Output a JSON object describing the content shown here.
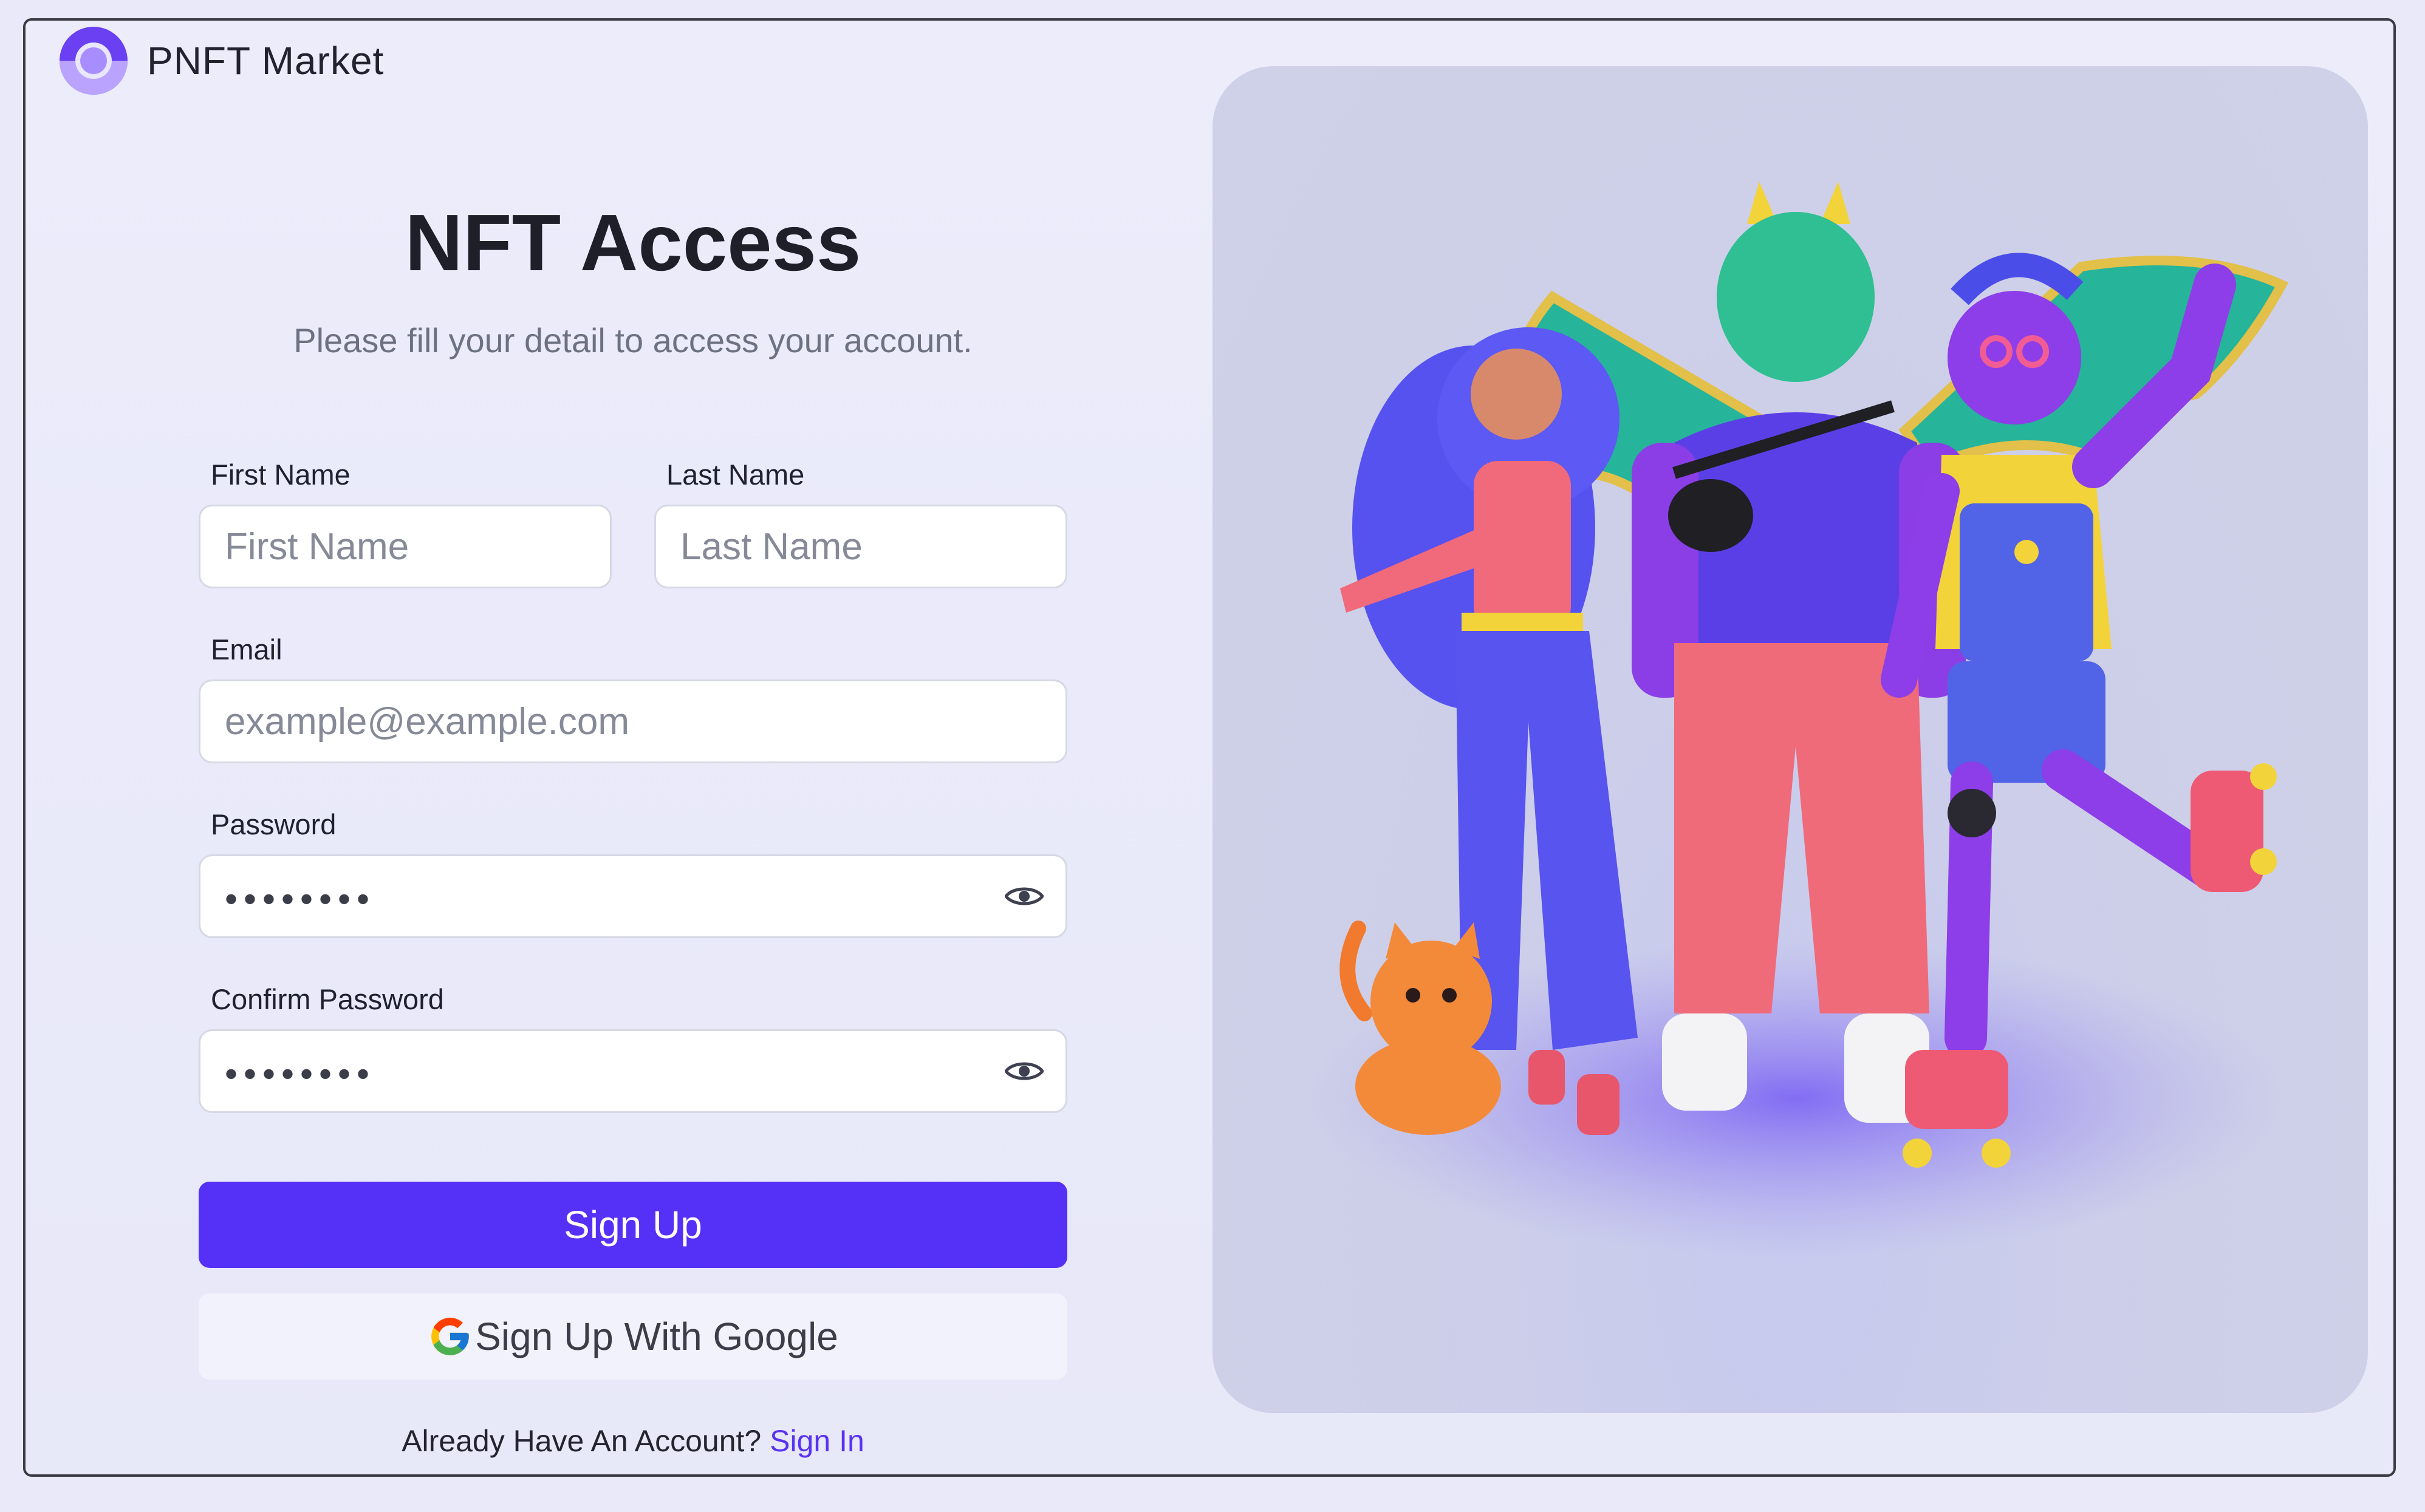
{
  "brand": {
    "name": "PNFT Market",
    "logo_icon": "brand-logo-icon"
  },
  "form": {
    "title": "NFT Access",
    "subtitle": "Please fill your detail to access your account.",
    "first_name": {
      "label": "First Name",
      "placeholder": "First Name"
    },
    "last_name": {
      "label": "Last Name",
      "placeholder": "Last Name"
    },
    "email": {
      "label": "Email",
      "placeholder": "example@example.com"
    },
    "password": {
      "label": "Password",
      "value_masked": "••••••••",
      "toggle_icon": "eye-icon"
    },
    "confirm_password": {
      "label": "Confirm Password",
      "value_masked": "••••••••",
      "toggle_icon": "eye-icon"
    },
    "signup_label": "Sign Up",
    "google_label": "Sign Up With Google",
    "signin_prompt": "Already Have An Account?",
    "signin_link": "Sign In"
  },
  "colors": {
    "accent": "#5530f6",
    "link": "#5a33f0",
    "panel_bg": "#cfd1e8",
    "page_bg": "#ececfb"
  },
  "illustration": {
    "icon": "characters-illustration"
  }
}
